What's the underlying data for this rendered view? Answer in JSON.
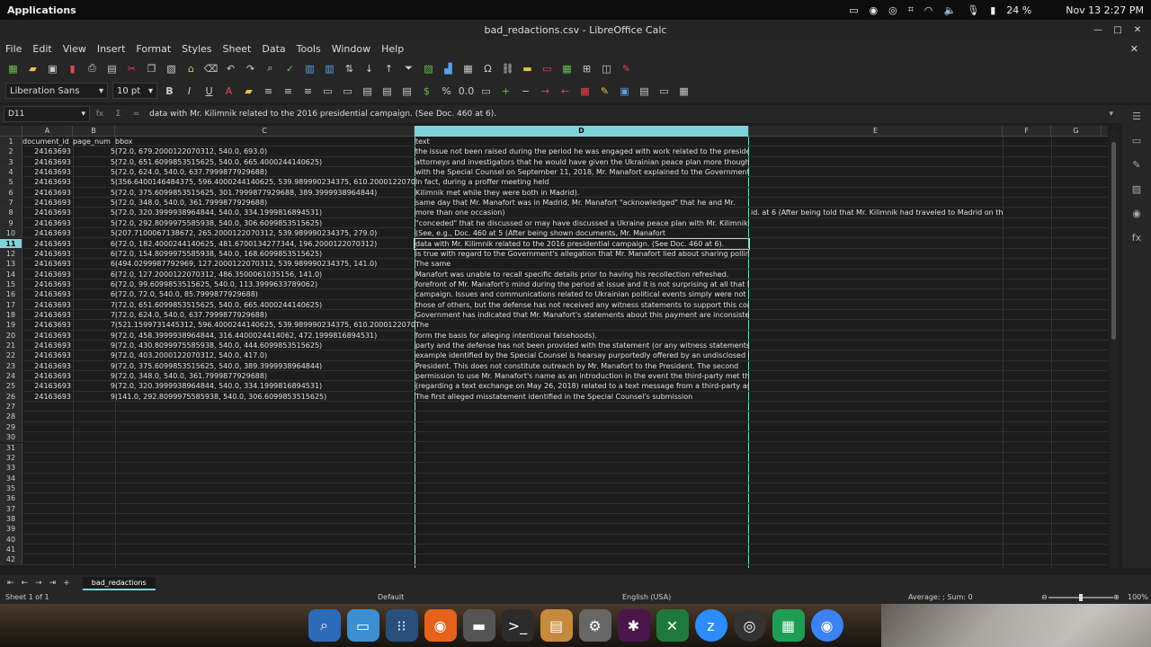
{
  "topbar": {
    "apps": "Applications",
    "battery": "24 %",
    "datetime": "Nov 13  2:27 PM"
  },
  "window": {
    "title": "bad_redactions.csv - LibreOffice Calc"
  },
  "menu": [
    "File",
    "Edit",
    "View",
    "Insert",
    "Format",
    "Styles",
    "Sheet",
    "Data",
    "Tools",
    "Window",
    "Help"
  ],
  "format": {
    "font_name": "Liberation Sans",
    "font_size": "10 pt"
  },
  "formula_bar": {
    "cell_ref": "D11",
    "content": "data with Mr. Kilimnik related to the 2016 presidential campaign.  (See Doc. 460 at 6)."
  },
  "columns": [
    "A",
    "B",
    "C",
    "D",
    "E",
    "F",
    "G"
  ],
  "headers": {
    "a": "document_id",
    "b": "page_num",
    "c": "bbox",
    "d": "text"
  },
  "rows": [
    {
      "n": "2",
      "a": "24163693",
      "b": "5",
      "c": "(72.0, 679.2000122070312, 540.0, 693.0)",
      "d": "the issue not been raised during the period he was engaged with work related to the presidential",
      "e": ""
    },
    {
      "n": "3",
      "a": "24163693",
      "b": "5",
      "c": "(72.0, 651.6099853515625, 540.0, 665.4000244140625)",
      "d": "attorneys and investigators that he would have given the Ukrainian peace plan more thought, had",
      "e": ""
    },
    {
      "n": "4",
      "a": "24163693",
      "b": "5",
      "c": "(72.0, 624.0, 540.0, 637.7999877929688)",
      "d": "with the Special Counsel on September 11, 2018, Mr. Manafort explained to the Government",
      "e": ""
    },
    {
      "n": "5",
      "a": "24163693",
      "b": "5",
      "c": "(356.6400146484375, 596.4000244140625, 539.989990234375, 610.2000122070312)",
      "d": "In fact, during a proffer meeting held",
      "e": ""
    },
    {
      "n": "6",
      "a": "24163693",
      "b": "5",
      "c": "(72.0, 375.6099853515625, 301.7999877929688, 389.3999938964844)",
      "d": "Kilimnik met while they were both in Madrid).",
      "e": ""
    },
    {
      "n": "7",
      "a": "24163693",
      "b": "5",
      "c": "(72.0, 348.0, 540.0, 361.7999877929688)",
      "d": "same day that Mr. Manafort was in Madrid, Mr. Manafort \"acknowledged\" that he and Mr.",
      "e": ""
    },
    {
      "n": "8",
      "a": "24163693",
      "b": "5",
      "c": "(72.0, 320.3999938964844, 540.0, 334.1999816894531)",
      "d": "more than one occasion)",
      "e": "id. at 6 (After being told that Mr. Kilimnik had traveled to Madrid on the"
    },
    {
      "n": "9",
      "a": "24163693",
      "b": "5",
      "c": "(72.0, 292.8099975585938, 540.0, 306.6099853515625)",
      "d": "\"conceded\" that he discussed or may have discussed a Ukraine peace plan with Mr. Kilimnik on",
      "e": ""
    },
    {
      "n": "10",
      "a": "24163693",
      "b": "5",
      "c": "(207.7100067138672, 265.2000122070312, 539.989990234375, 279.0)",
      "d": "(See, e.g., Doc. 460 at 5 (After being shown documents, Mr. Manafort",
      "e": ""
    },
    {
      "n": "11",
      "a": "24163693",
      "b": "6",
      "c": "(72.0, 182.4000244140625, 481.6700134277344, 196.2000122070312)",
      "d": "data with Mr. Kilimnik related to the 2016 presidential campaign.  (See Doc. 460 at 6).",
      "e": ""
    },
    {
      "n": "12",
      "a": "24163693",
      "b": "6",
      "c": "(72.0, 154.8099975585938, 540.0, 168.6099853515625)",
      "d": "is true with regard to the Government's allegation that Mr. Manafort lied about sharing polling",
      "e": ""
    },
    {
      "n": "13",
      "a": "24163693",
      "b": "6",
      "c": "(494.0299987792969, 127.2000122070312, 539.989990234375, 141.0)",
      "d": "The same",
      "e": ""
    },
    {
      "n": "14",
      "a": "24163693",
      "b": "6",
      "c": "(72.0, 127.2000122070312, 486.3500061035156, 141.0)",
      "d": "Manafort was unable to recall specific details prior to having his recollection refreshed.",
      "e": ""
    },
    {
      "n": "15",
      "a": "24163693",
      "b": "6",
      "c": "(72.0, 99.6099853515625, 540.0, 113.3999633789062)",
      "d": "forefront of Mr. Manafort's mind during the period at issue and it is not surprising at all that Mr.",
      "e": ""
    },
    {
      "n": "16",
      "a": "24163693",
      "b": "6",
      "c": "(72.0, 72.0, 540.0, 85.7999877929688)",
      "d": "campaign.  Issues and communications related to Ukrainian political events simply were not at the",
      "e": ""
    },
    {
      "n": "17",
      "a": "24163693",
      "b": "7",
      "c": "(72.0, 651.6099853515625, 540.0, 665.4000244140625)",
      "d": "those of others, but the defense has not received any witness statements to support this contention.",
      "e": ""
    },
    {
      "n": "18",
      "a": "24163693",
      "b": "7",
      "c": "(72.0, 624.0, 540.0, 637.7999877929688)",
      "d": "Government has indicated that Mr. Manafort's statements about this payment are inconsistent with",
      "e": ""
    },
    {
      "n": "19",
      "a": "24163693",
      "b": "7",
      "c": "(521.1599731445312, 596.4000244140625, 539.989990234375, 610.2000122070312)",
      "d": "The",
      "e": ""
    },
    {
      "n": "20",
      "a": "24163693",
      "b": "9",
      "c": "(72.0, 458.3999938964844, 316.4400024414062, 472.1999816894531)",
      "d": "form the basis for alleging intentional falsehoods).",
      "e": ""
    },
    {
      "n": "21",
      "a": "24163693",
      "b": "9",
      "c": "(72.0, 430.8099975585938, 540.0, 444.6099853515625)",
      "d": "party and the defense has not been provided with the statement (or any witness statements that",
      "e": ""
    },
    {
      "n": "22",
      "a": "24163693",
      "b": "9",
      "c": "(72.0, 403.2000122070312, 540.0, 417.0)",
      "d": "example identified by the Special Counsel is hearsay purportedly offered by an undisclosed third",
      "e": ""
    },
    {
      "n": "23",
      "a": "24163693",
      "b": "9",
      "c": "(72.0, 375.6099853515625, 540.0, 389.3999938964844)",
      "d": "President.  This does not constitute outreach by Mr. Manafort to the President.  The second",
      "e": ""
    },
    {
      "n": "24",
      "a": "24163693",
      "b": "9",
      "c": "(72.0, 348.0, 540.0, 361.7999877929688)",
      "d": "permission to use Mr. Manafort's name as an introduction in the event the third-party met the",
      "e": ""
    },
    {
      "n": "25",
      "a": "24163693",
      "b": "9",
      "c": "(72.0, 320.3999938964844, 540.0, 334.1999816894531)",
      "d": "(regarding a text exchange on May 26, 2018) related to a text message from a third-party asking",
      "e": ""
    },
    {
      "n": "26",
      "a": "24163693",
      "b": "9",
      "c": "(141.0, 292.8099975585938, 540.0, 306.6099853515625)",
      "d": "The first alleged misstatement identified in the Special Counsel's submission",
      "e": ""
    }
  ],
  "empty_rows": [
    "27",
    "28",
    "29",
    "30",
    "31",
    "32",
    "33",
    "34",
    "35",
    "36",
    "37",
    "38",
    "39",
    "40",
    "41",
    "42"
  ],
  "selected_row": "11",
  "sheet_tab": "bad_redactions",
  "status": {
    "sheet": "Sheet 1 of 1",
    "style": "Default",
    "language": "English (USA)",
    "summary": "Average: ; Sum: 0",
    "zoom": "100%"
  },
  "accent": "#7fd4d9"
}
